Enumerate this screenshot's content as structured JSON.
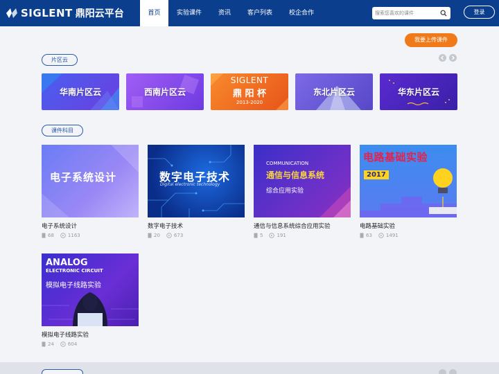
{
  "header": {
    "brand": "SIGLENT",
    "brand_cn": "鼎阳云平台",
    "nav": [
      {
        "label": "首页",
        "active": true
      },
      {
        "label": "实验课件",
        "active": false
      },
      {
        "label": "资讯",
        "active": false
      },
      {
        "label": "客户列表",
        "active": false
      },
      {
        "label": "校企合作",
        "active": false
      }
    ],
    "search_placeholder": "搜索您喜欢的课件",
    "login_label": "登录"
  },
  "upload_label": "我要上传课件",
  "regions": {
    "title": "片区云",
    "items": [
      {
        "label": "华南片区云",
        "color": "#5b4ee6"
      },
      {
        "label": "西南片区云",
        "color": "#8a4de8"
      },
      {
        "label": "SIGLENT",
        "sub": "鼎 阳 杯",
        "years": "2013-2020",
        "color": "#f26b1d"
      },
      {
        "label": "东北片区云",
        "color": "#6a55d6"
      },
      {
        "label": "华东片区云",
        "color": "#4a2fc0"
      }
    ]
  },
  "courses": {
    "title": "课件科目",
    "items": [
      {
        "title": "电子系统设计",
        "thumb_text": "电子系统设计",
        "files": "68",
        "views": "1163"
      },
      {
        "title": "数字电子技术",
        "thumb_text": "数字电子技术",
        "thumb_sub": "Digital electronic technology",
        "files": "20",
        "views": "673"
      },
      {
        "title": "通信与信息系统综合应用实验",
        "thumb_en": "COMMUNICATION",
        "thumb_text": "通信与信息系统",
        "thumb_sub": "综合应用实验",
        "files": "5",
        "views": "191"
      },
      {
        "title": "电路基础实验",
        "thumb_text": "电路基础实验",
        "thumb_year": "2017",
        "files": "63",
        "views": "1491"
      },
      {
        "title": "模拟电子线路实验",
        "thumb_en": "ANALOG",
        "thumb_en2": "ELECTRONIC CIRCUIT",
        "thumb_text": "模拟电子线路实验",
        "files": "24",
        "views": "604"
      }
    ]
  },
  "colors": {
    "brand": "#0b3f8e",
    "accent": "#f07a1a",
    "tag": "#2a5aa8"
  }
}
